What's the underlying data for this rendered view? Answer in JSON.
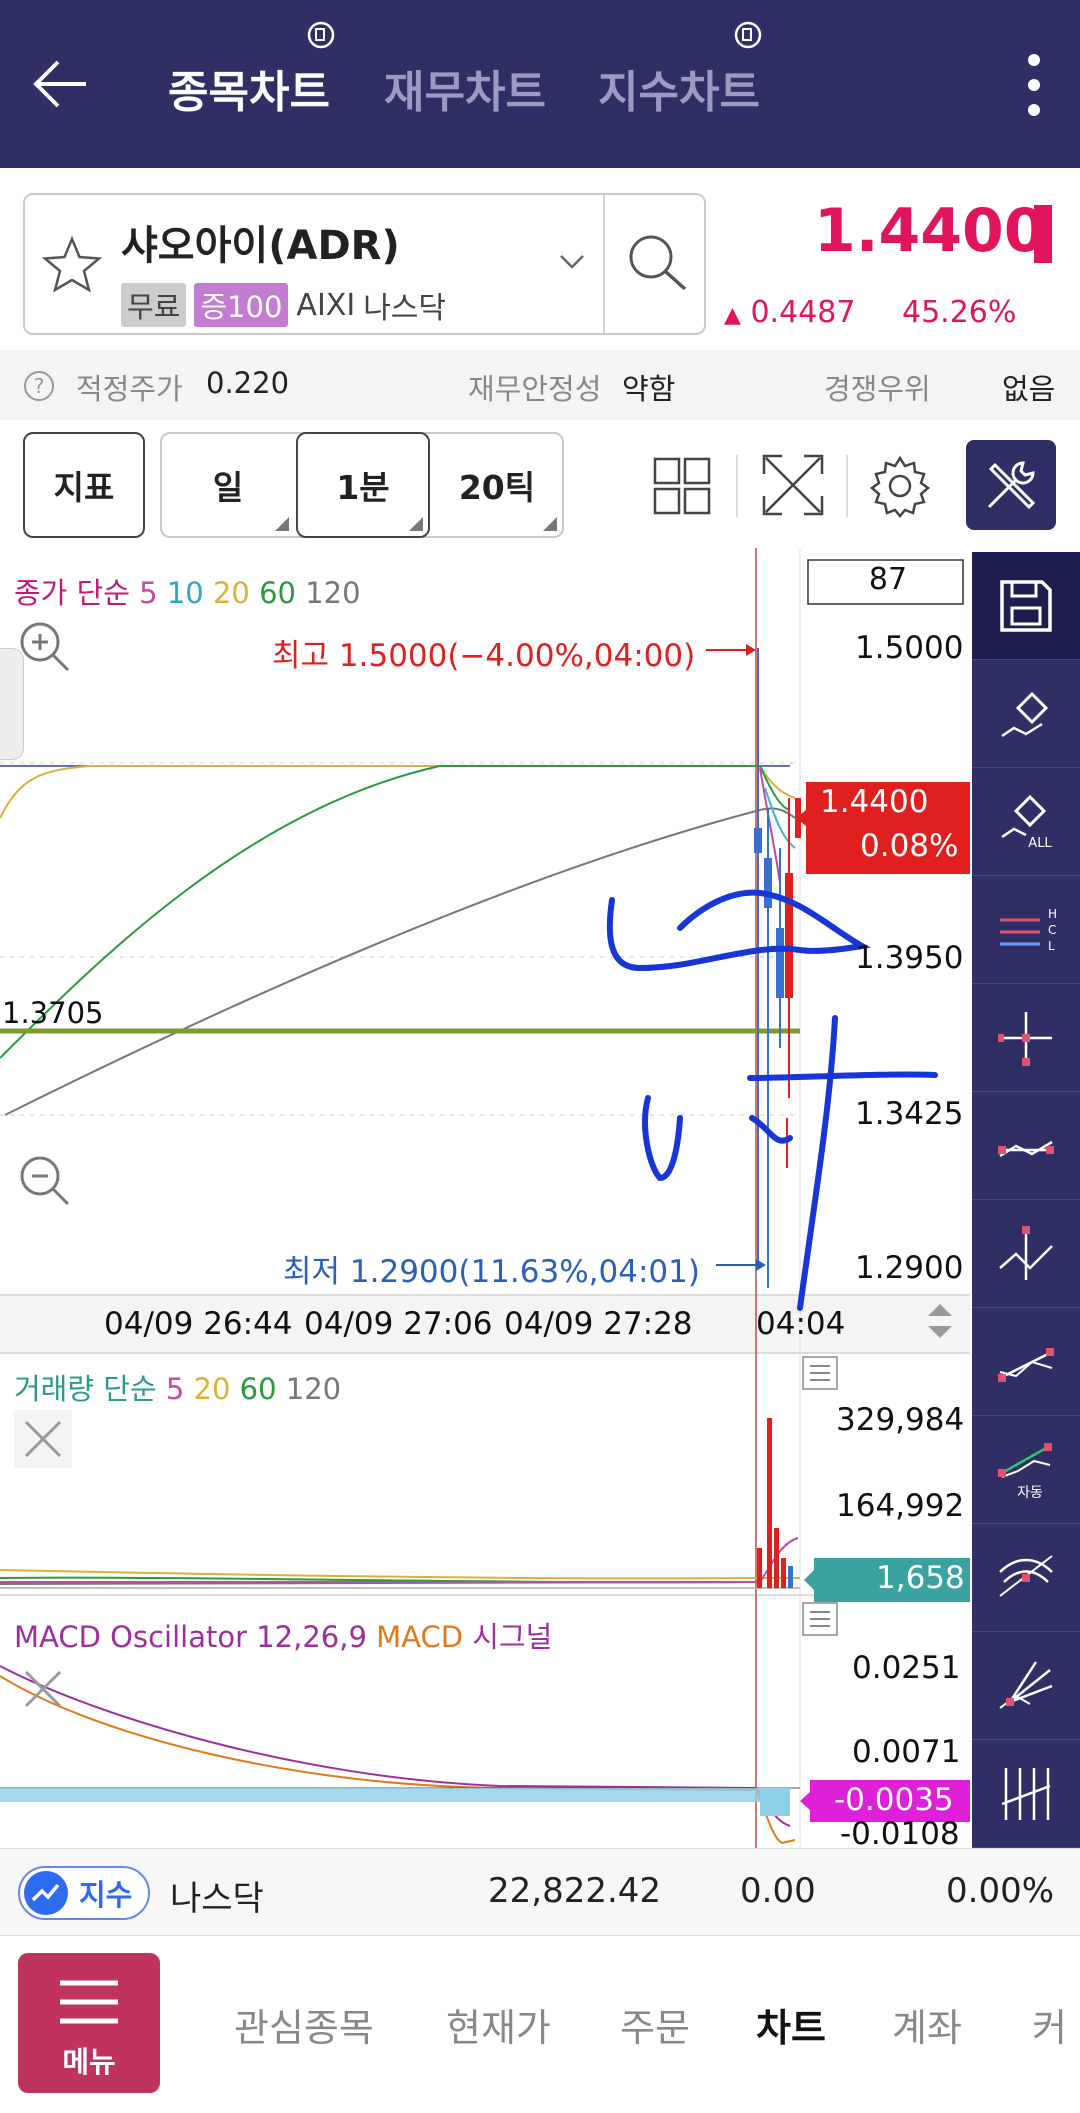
{
  "header": {
    "tabs": [
      {
        "label": "종목차트",
        "active": true
      },
      {
        "label": "재무차트",
        "active": false
      },
      {
        "label": "지수차트",
        "active": false
      }
    ]
  },
  "stock": {
    "name": "샤오아이(ADR)",
    "tags": [
      "무료",
      "증100"
    ],
    "ticker": "AIXI",
    "market": "나스닥",
    "price": "1.4400",
    "change": "0.4487",
    "change_pct": "45.26%",
    "up_color": "#e0155e"
  },
  "subbar": {
    "fair_price_label": "적정주가",
    "fair_price_value": "0.220",
    "stability_label": "재무안정성",
    "stability_value": "약함",
    "competitive_label": "경쟁우위",
    "competitive_value": "없음"
  },
  "toolbar": {
    "indicator_label": "지표",
    "period_day": "일",
    "period_1min": "1분",
    "period_20tick": "20틱"
  },
  "chart": {
    "count_box": "87",
    "price_legend": {
      "prefix": "종가 단순",
      "p5": "5",
      "p10": "10",
      "p20": "20",
      "p60": "60",
      "p120": "120"
    },
    "high_label": "최고 1.5000(−4.00%,04:00)",
    "low_label": "최저 1.2900(11.63%,04:01)",
    "left_level": "1.3705",
    "price_axis": [
      "1.5000",
      "1.3950",
      "1.3425",
      "1.2900"
    ],
    "current_price_tag": "1.4400",
    "current_pct_tag": "0.08%",
    "time_axis": [
      "04/09 26:44",
      "04/09 27:06",
      "04/09 27:28",
      "04:04"
    ],
    "volume_legend": {
      "prefix": "거래량 단순",
      "p5": "5",
      "p20": "20",
      "p60": "60",
      "p120": "120"
    },
    "volume_axis": [
      "329,984",
      "164,992"
    ],
    "volume_tag": "1,658",
    "macd_legend": {
      "a": "MACD Oscillator 12,26,9",
      "b": "MACD",
      "c": "시그널"
    },
    "macd_axis": [
      "0.0251",
      "0.0071",
      "-0.0108"
    ],
    "macd_tag": "-0.0035"
  },
  "index_bar": {
    "badge": "지수",
    "name": "나스닥",
    "value": "22,822.42",
    "change": "0.00",
    "pct": "0.00%"
  },
  "bottom_nav": {
    "menu_label": "메뉴",
    "items": [
      "관심종목",
      "현재가",
      "주문",
      "차트",
      "계좌",
      "커"
    ]
  },
  "side_tools": {
    "auto_label": "자동",
    "all_label": "ALL"
  }
}
